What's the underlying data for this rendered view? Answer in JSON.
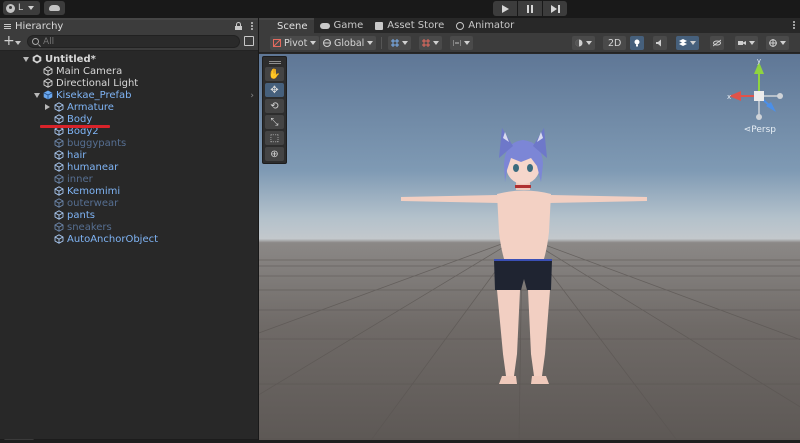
{
  "topbar": {
    "account_label": "L"
  },
  "hierarchy": {
    "tab_title": "Hierarchy",
    "search_placeholder": "All",
    "rows": [
      {
        "label": "Untitled*",
        "color": "white",
        "indent": 0,
        "fold": "open",
        "bold": true,
        "icon": "unity-scene-icon"
      },
      {
        "label": "Main Camera",
        "color": "white",
        "indent": 1,
        "fold": "",
        "icon": "cube-icon"
      },
      {
        "label": "Directional Light",
        "color": "white",
        "indent": 1,
        "fold": "",
        "icon": "cube-icon"
      },
      {
        "label": "Kisekae_Prefab",
        "color": "blue",
        "indent": 1,
        "fold": "open",
        "icon": "prefab-icon",
        "chevron": true
      },
      {
        "label": "Armature",
        "color": "blue",
        "indent": 2,
        "fold": "closed",
        "icon": "cube-icon"
      },
      {
        "label": "Body",
        "color": "blue",
        "indent": 2,
        "fold": "",
        "icon": "cube-icon"
      },
      {
        "label": "Body2",
        "color": "blue",
        "indent": 2,
        "fold": "",
        "icon": "cube-icon"
      },
      {
        "label": "buggypants",
        "color": "dim",
        "indent": 2,
        "fold": "",
        "icon": "cube-icon"
      },
      {
        "label": "hair",
        "color": "blue",
        "indent": 2,
        "fold": "",
        "icon": "cube-icon"
      },
      {
        "label": "humanear",
        "color": "blue",
        "indent": 2,
        "fold": "",
        "icon": "cube-icon"
      },
      {
        "label": "inner",
        "color": "dim",
        "indent": 2,
        "fold": "",
        "icon": "cube-icon"
      },
      {
        "label": "Kemomimi",
        "color": "blue",
        "indent": 2,
        "fold": "",
        "icon": "cube-icon"
      },
      {
        "label": "outerwear",
        "color": "dim",
        "indent": 2,
        "fold": "",
        "icon": "cube-icon"
      },
      {
        "label": "pants",
        "color": "blue",
        "indent": 2,
        "fold": "",
        "icon": "cube-icon"
      },
      {
        "label": "sneakers",
        "color": "dim",
        "indent": 2,
        "fold": "",
        "icon": "cube-icon"
      },
      {
        "label": "AutoAnchorObject",
        "color": "blue",
        "indent": 2,
        "fold": "",
        "icon": "cube-icon"
      }
    ]
  },
  "scene": {
    "tabs": [
      {
        "label": "Scene",
        "icon": "grid-icon",
        "active": true
      },
      {
        "label": "Game",
        "icon": "gamepad-icon",
        "active": false
      },
      {
        "label": "Asset Store",
        "icon": "store-icon",
        "active": false
      },
      {
        "label": "Animator",
        "icon": "animator-icon",
        "active": false
      }
    ],
    "toolbar": {
      "pivot_label": "Pivot",
      "global_label": "Global",
      "mode_2d_label": "2D"
    },
    "gizmo": {
      "x_label": "x",
      "y_label": "y",
      "persp_label": "Persp"
    },
    "colors": {
      "x_axis": "#e0534a",
      "y_axis": "#8fd43f",
      "z_axis": "#4b8fe8",
      "hair": "#7a86d8",
      "skin": "#f3d0c4",
      "shorts": "#1f2431"
    }
  }
}
